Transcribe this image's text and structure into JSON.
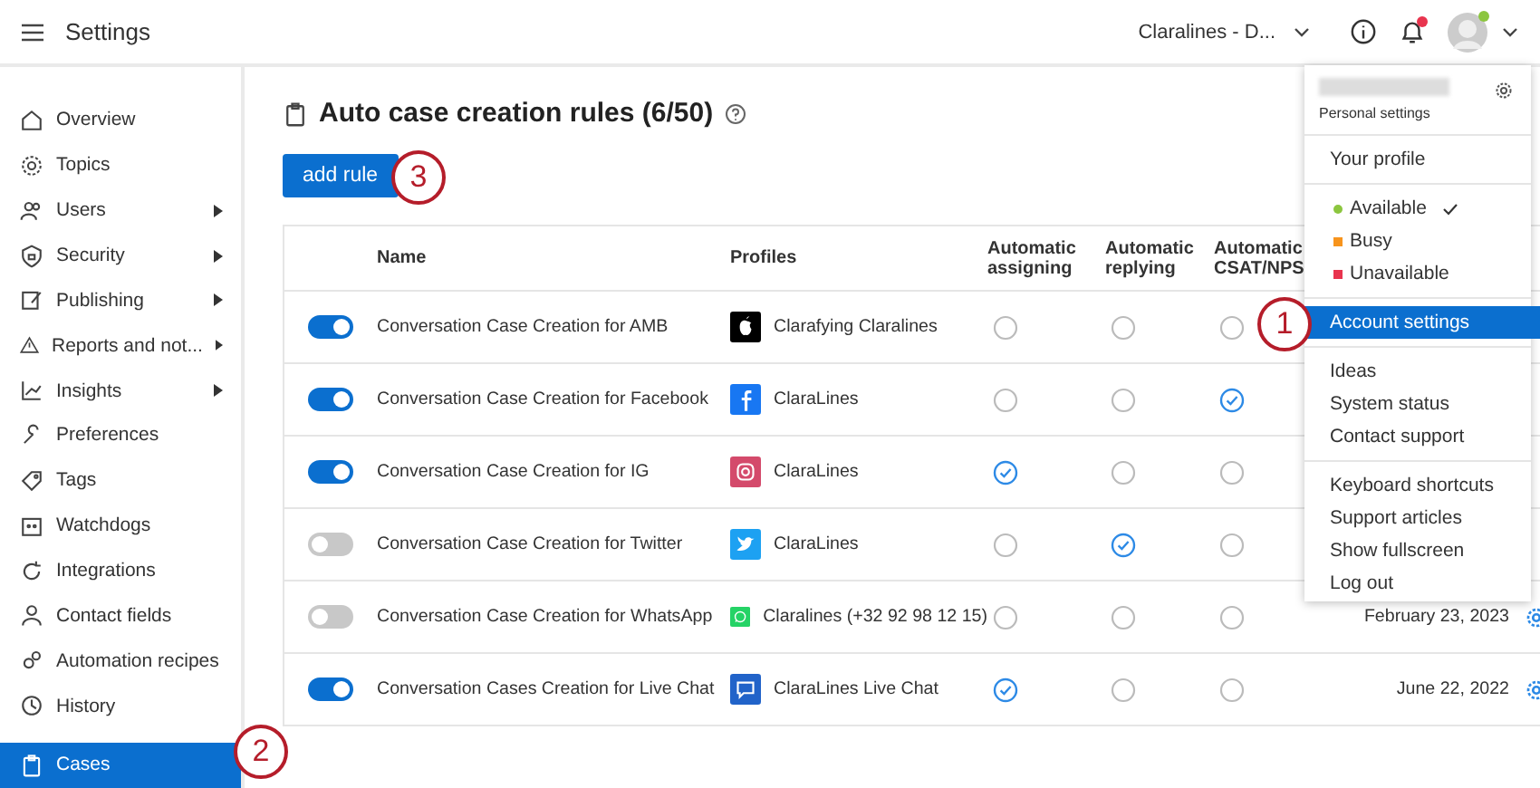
{
  "header": {
    "title": "Settings",
    "account": "Claralines - D...",
    "notifications_unread": true,
    "user_available": true
  },
  "sidebar": {
    "items": [
      {
        "label": "Overview",
        "has_submenu": false,
        "selected": false
      },
      {
        "label": "Topics",
        "has_submenu": false,
        "selected": false
      },
      {
        "label": "Users",
        "has_submenu": true,
        "selected": false
      },
      {
        "label": "Security",
        "has_submenu": true,
        "selected": false
      },
      {
        "label": "Publishing",
        "has_submenu": true,
        "selected": false
      },
      {
        "label": "Reports and not...",
        "has_submenu": true,
        "selected": false
      },
      {
        "label": "Insights",
        "has_submenu": true,
        "selected": false
      },
      {
        "label": "Preferences",
        "has_submenu": false,
        "selected": false
      },
      {
        "label": "Tags",
        "has_submenu": false,
        "selected": false
      },
      {
        "label": "Watchdogs",
        "has_submenu": false,
        "selected": false
      },
      {
        "label": "Integrations",
        "has_submenu": false,
        "selected": false
      },
      {
        "label": "Contact fields",
        "has_submenu": false,
        "selected": false
      },
      {
        "label": "Automation recipes",
        "has_submenu": false,
        "selected": false
      },
      {
        "label": "History",
        "has_submenu": false,
        "selected": false
      },
      {
        "label": "Cases",
        "has_submenu": false,
        "selected": true
      }
    ]
  },
  "page": {
    "title": "Auto case creation rules (6/50)",
    "add_button": "add rule"
  },
  "table": {
    "columns": [
      "Name",
      "Profiles",
      "Automatic assigning",
      "Automatic replying",
      "Automatic CSAT/NPS"
    ],
    "rows": [
      {
        "enabled": true,
        "name": "Conversation Case Creation for AMB",
        "profile": {
          "kind": "apple",
          "label": "Clarafying Claralines"
        },
        "assigning": false,
        "replying": false,
        "csat": false
      },
      {
        "enabled": true,
        "name": "Conversation Case Creation for Facebook",
        "profile": {
          "kind": "facebook",
          "label": "ClaraLines"
        },
        "assigning": false,
        "replying": false,
        "csat": true
      },
      {
        "enabled": true,
        "name": "Conversation Case Creation for IG",
        "profile": {
          "kind": "instagram",
          "label": "ClaraLines"
        },
        "assigning": true,
        "replying": false,
        "csat": false
      },
      {
        "enabled": false,
        "name": "Conversation Case Creation for Twitter",
        "profile": {
          "kind": "twitter",
          "label": "ClaraLines"
        },
        "assigning": false,
        "replying": true,
        "csat": false
      },
      {
        "enabled": false,
        "name": "Conversation Case Creation for WhatsApp",
        "profile": {
          "kind": "whatsapp",
          "label": "Claralines (+32 92 98 12 15)"
        },
        "assigning": false,
        "replying": false,
        "csat": false,
        "date": "February 23, 2023"
      },
      {
        "enabled": true,
        "name": "Conversation Cases Creation for Live Chat",
        "profile": {
          "kind": "chat",
          "label": "ClaraLines Live Chat"
        },
        "assigning": true,
        "replying": false,
        "csat": false,
        "date": "June 22, 2022"
      }
    ]
  },
  "user_menu": {
    "personal_settings": "Personal settings",
    "sections": [
      [
        {
          "label": "Your profile",
          "selected": false
        }
      ],
      [
        {
          "label": "Available",
          "color": "#8cc63f",
          "checked": true,
          "selected": false
        },
        {
          "label": "Busy",
          "color": "#f7941d",
          "checked": false,
          "selected": false
        },
        {
          "label": "Unavailable",
          "color": "#e8344e",
          "checked": false,
          "selected": false
        }
      ],
      [
        {
          "label": "Account settings",
          "selected": true
        }
      ],
      [
        {
          "label": "Ideas",
          "selected": false
        },
        {
          "label": "System status",
          "selected": false
        },
        {
          "label": "Contact support",
          "selected": false
        }
      ],
      [
        {
          "label": "Keyboard shortcuts",
          "selected": false
        },
        {
          "label": "Support articles",
          "selected": false
        },
        {
          "label": "Show fullscreen",
          "selected": false
        },
        {
          "label": "Log out",
          "selected": false
        }
      ]
    ]
  },
  "callouts": [
    {
      "number": "1"
    },
    {
      "number": "2"
    },
    {
      "number": "3"
    }
  ]
}
